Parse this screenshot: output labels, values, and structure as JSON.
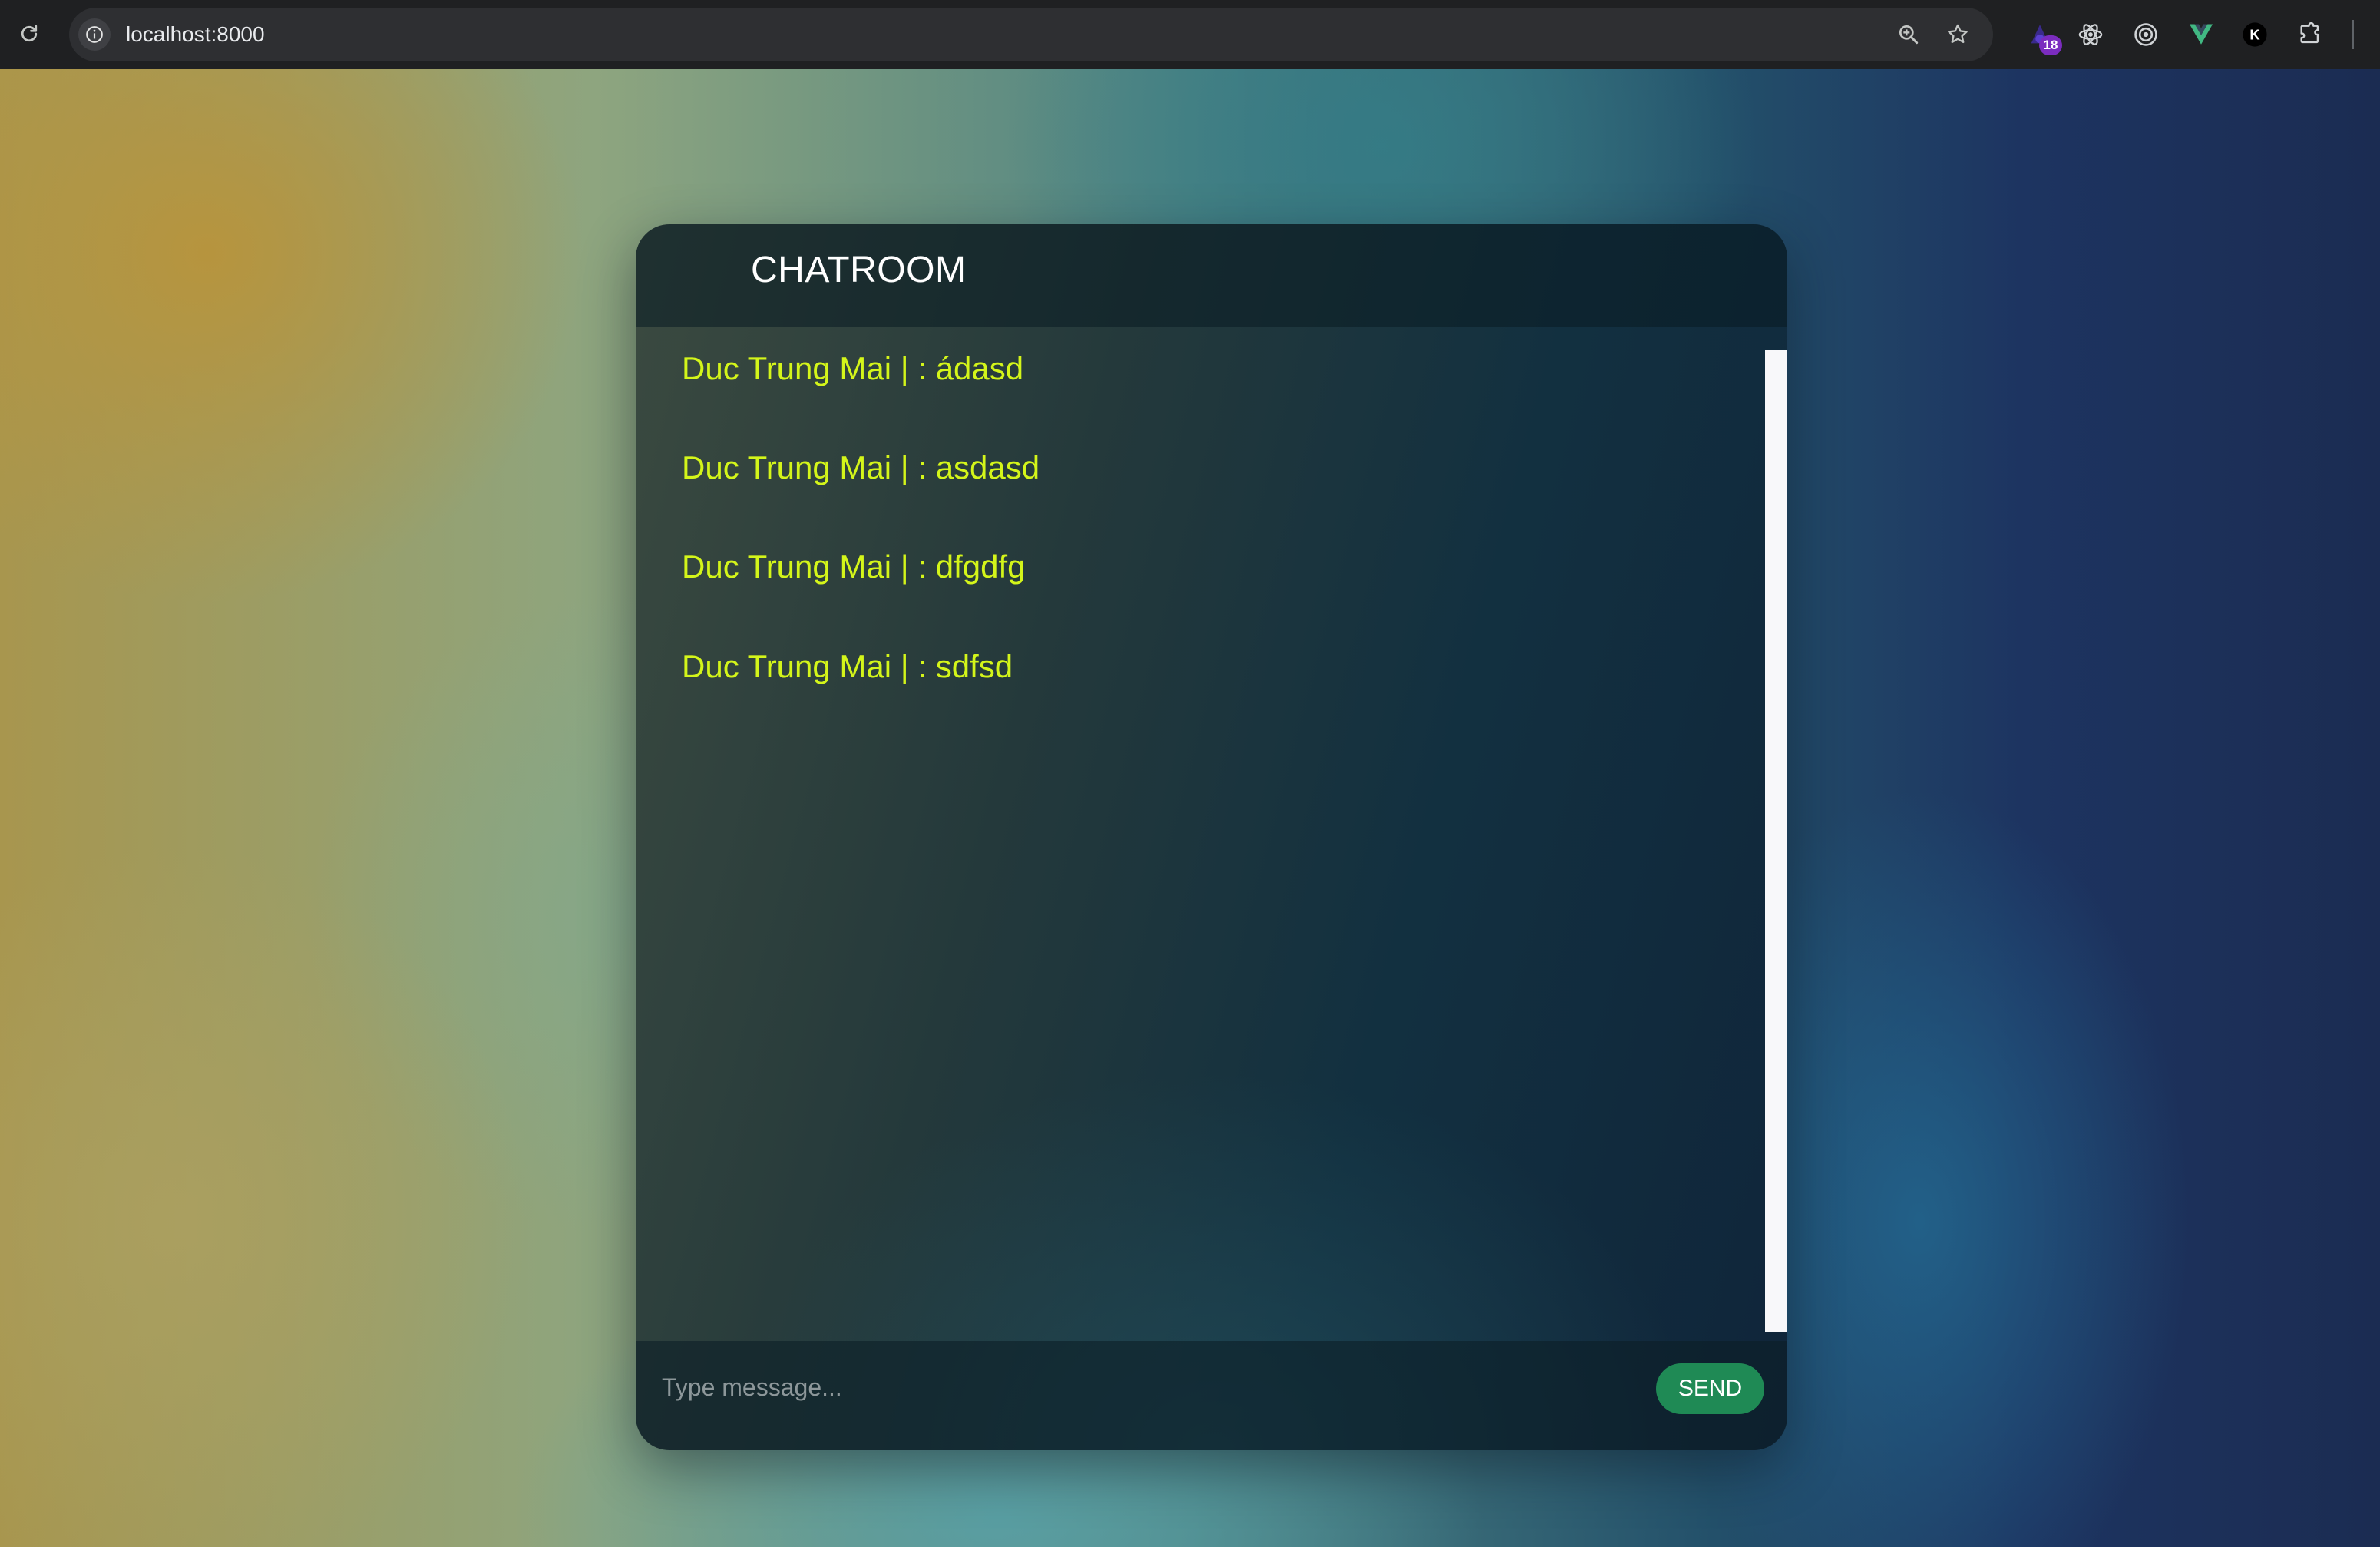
{
  "browser": {
    "url": "localhost:8000",
    "extensions": [
      {
        "name": "wizard-extension-icon",
        "badge": "18"
      },
      {
        "name": "react-devtools-icon"
      },
      {
        "name": "target-extension-icon"
      },
      {
        "name": "vue-devtools-icon"
      },
      {
        "name": "k-extension-icon",
        "glyph": "K"
      },
      {
        "name": "puzzle-extensions-icon"
      }
    ]
  },
  "chat": {
    "title": "CHATROOM",
    "messages": [
      {
        "text": "Duc Trung Mai | : ádasd"
      },
      {
        "text": "Duc Trung Mai | : asdasd"
      },
      {
        "text": "Duc Trung Mai | : dfgdfg"
      },
      {
        "text": "Duc Trung Mai | : sdfsd"
      }
    ],
    "input": {
      "placeholder": "Type message...",
      "value": ""
    },
    "send_label": "SEND",
    "colors": {
      "message_text": "#d4f51a",
      "send_button": "#1f8a55",
      "title_text": "#ffffff"
    }
  }
}
